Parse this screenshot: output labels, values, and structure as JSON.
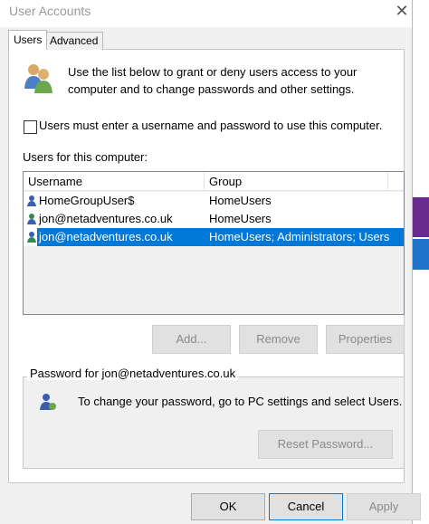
{
  "window": {
    "title": "User Accounts",
    "close_glyph": "✕"
  },
  "tabs": [
    {
      "label": "Users"
    },
    {
      "label": "Advanced"
    }
  ],
  "intro": {
    "text": "Use the list below to grant or deny users access to your computer and to change passwords and other settings.",
    "icon": "users-icon"
  },
  "checkbox": {
    "label": "Users must enter a username and password to use this computer.",
    "checked": false
  },
  "users_section": {
    "label": "Users for this computer:",
    "columns": [
      "Username",
      "Group"
    ],
    "rows": [
      {
        "username": "HomeGroupUser$",
        "group": "HomeUsers",
        "selected": false
      },
      {
        "username": "jon@netadventures.co.uk",
        "group": "HomeUsers",
        "selected": false
      },
      {
        "username": "jon@netadventures.co.uk",
        "group": "HomeUsers; Administrators; Users",
        "selected": true
      }
    ]
  },
  "list_buttons": {
    "add": "Add...",
    "remove": "Remove",
    "properties": "Properties"
  },
  "password_section": {
    "legend": "Password for jon@netadventures.co.uk",
    "text": "To change your password, go to PC settings and select Users.",
    "reset": "Reset Password..."
  },
  "footer": {
    "ok": "OK",
    "cancel": "Cancel",
    "apply": "Apply"
  },
  "colors": {
    "selection": "#0078d7",
    "dialog_bg": "#f0f0f0"
  }
}
